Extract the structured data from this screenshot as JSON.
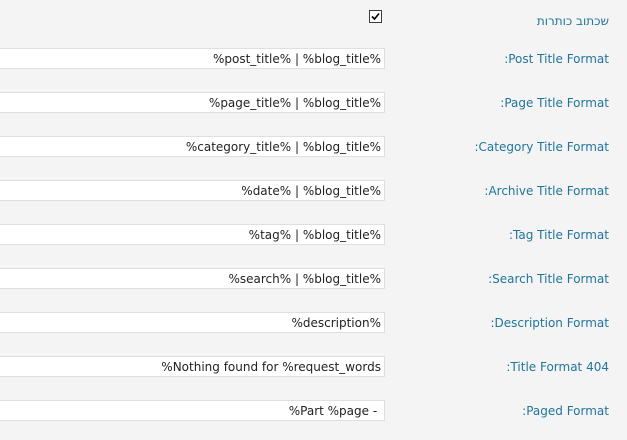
{
  "rewrite_titles": {
    "label": "שכתוב כותרות",
    "checked": true
  },
  "fields": [
    {
      "label": "Post Title Format:",
      "value": "%post_title% | %blog_title%"
    },
    {
      "label": "Page Title Format:",
      "value": "%page_title% | %blog_title%"
    },
    {
      "label": "Category Title Format:",
      "value": "%category_title% | %blog_title%"
    },
    {
      "label": "Archive Title Format:",
      "value": "%date% | %blog_title%"
    },
    {
      "label": "Tag Title Format:",
      "value": "%tag% | %blog_title%"
    },
    {
      "label": "Search Title Format:",
      "value": "%search% | %blog_title%"
    },
    {
      "label": "Description Format:",
      "value": "%description%"
    },
    {
      "label": "404 Title Format:",
      "value": "Nothing found for %request_words%"
    },
    {
      "label": "Paged Format:",
      "value": " - Part %page%"
    }
  ],
  "colors": {
    "label": "#21759b",
    "background": "#f4f4f4",
    "input_border": "#dfdfdf"
  }
}
